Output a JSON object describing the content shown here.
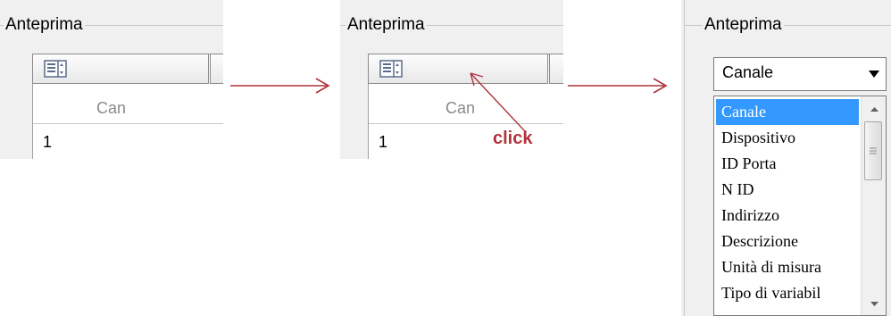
{
  "steps": [
    {
      "group_title": "Anteprima",
      "column_header": "Can",
      "row_value": "1"
    },
    {
      "group_title": "Anteprima",
      "column_header": "Can",
      "row_value": "1",
      "annotation": "click"
    },
    {
      "group_title": "Anteprima",
      "combo_value": "Canale",
      "options": [
        "Canale",
        "Dispositivo",
        "ID Porta",
        "N ID",
        "Indirizzo",
        "Descrizione",
        "Unità di misura",
        "Tipo di variabil"
      ],
      "selected_option": "Canale"
    }
  ],
  "colors": {
    "arrow": "#b0323c",
    "selection": "#3399ff",
    "panel_bg": "#f0f0f0"
  },
  "icons": [
    "layout-icon",
    "arrow-right-icon",
    "dropdown-arrow-icon",
    "scroll-up-icon",
    "scroll-down-icon",
    "scroll-thumb"
  ]
}
